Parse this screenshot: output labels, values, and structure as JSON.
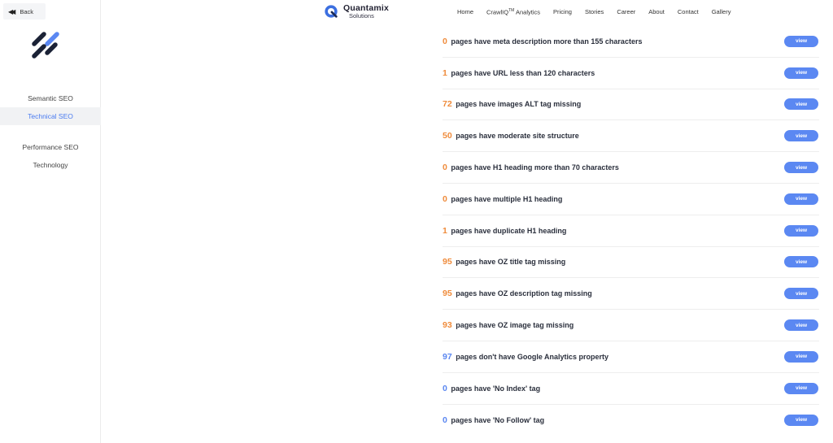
{
  "sidebar": {
    "back_label": "Back",
    "items": [
      {
        "label": "Semantic SEO",
        "active": false
      },
      {
        "label": "Technical SEO",
        "active": true
      },
      {
        "label": "Performance SEO",
        "active": false
      },
      {
        "label": "Technology",
        "active": false
      }
    ]
  },
  "brand": {
    "name": "Quantamix",
    "sub": "Solutions"
  },
  "nav": {
    "home": "Home",
    "crawliq": "CrawlIQ",
    "crawliq_sup": "TM",
    "crawliq_suffix": " Analytics",
    "pricing": "Pricing",
    "stories": "Stories",
    "career": "Career",
    "about": "About",
    "contact": "Contact",
    "gallery": "Gallery"
  },
  "colors": {
    "accent": "#5b88f2",
    "count_orange": "#ef8b3b",
    "count_blue": "#5a86f0"
  },
  "rows": [
    {
      "count": "0",
      "text": "pages have meta description more than 155 characters",
      "color": "orange",
      "button": "view"
    },
    {
      "count": "1",
      "text": "pages have URL less than 120 characters",
      "color": "orange",
      "button": "view"
    },
    {
      "count": "72",
      "text": "pages have images ALT tag missing",
      "color": "orange",
      "button": "view"
    },
    {
      "count": "50",
      "text": "pages have moderate site structure",
      "color": "orange",
      "button": "view"
    },
    {
      "count": "0",
      "text": "pages have H1 heading more than 70 characters",
      "color": "orange",
      "button": "view"
    },
    {
      "count": "0",
      "text": "pages have multiple H1 heading",
      "color": "orange",
      "button": "view"
    },
    {
      "count": "1",
      "text": "pages have duplicate H1 heading",
      "color": "orange",
      "button": "view"
    },
    {
      "count": "95",
      "text": "pages have OZ title tag missing",
      "color": "orange",
      "button": "view"
    },
    {
      "count": "95",
      "text": "pages have OZ description tag missing",
      "color": "orange",
      "button": "view"
    },
    {
      "count": "93",
      "text": "pages have OZ image tag missing",
      "color": "orange",
      "button": "view"
    },
    {
      "count": "97",
      "text": "pages don't have Google Analytics property",
      "color": "blue",
      "button": "view"
    },
    {
      "count": "0",
      "text": "pages have 'No Index' tag",
      "color": "blue",
      "button": "view"
    },
    {
      "count": "0",
      "text": "pages have 'No Follow' tag",
      "color": "blue",
      "button": "view"
    }
  ]
}
